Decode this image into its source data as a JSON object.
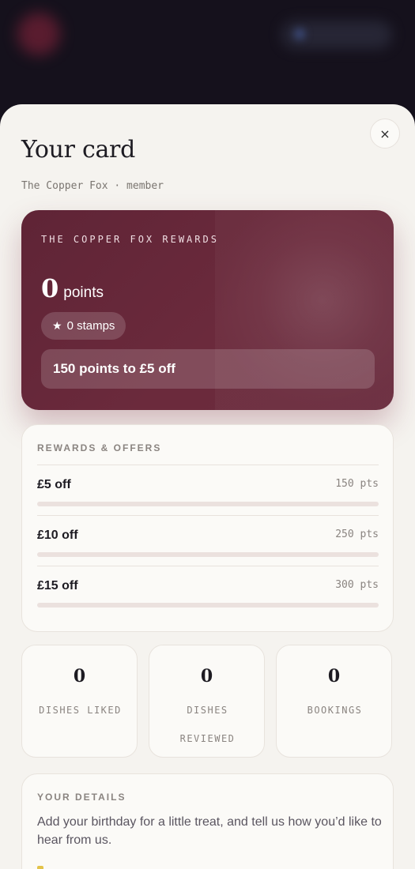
{
  "sheet": {
    "title": "Your card",
    "subtitle": "The Copper Fox · member",
    "close_label": "×"
  },
  "card": {
    "brand": "THE COPPER FOX REWARDS",
    "points_value": "0",
    "points_label": "points",
    "stamps_icon": "★",
    "stamps_label": "0 stamps",
    "next_reward": "150 points to £5 off",
    "accent_color": "#6b2a3c"
  },
  "rewards": {
    "heading": "REWARDS & OFFERS",
    "items": [
      {
        "name": "£5 off",
        "cost": "150 pts",
        "progress": 0
      },
      {
        "name": "£10 off",
        "cost": "250 pts",
        "progress": 0
      },
      {
        "name": "£15 off",
        "cost": "300 pts",
        "progress": 0
      }
    ]
  },
  "stats": [
    {
      "value": "0",
      "label": "DISHES LIKED"
    },
    {
      "value": "0",
      "label": "DISHES REVIEWED"
    },
    {
      "value": "0",
      "label": "BOOKINGS"
    }
  ],
  "details": {
    "heading": "YOUR DETAILS",
    "text": "Add your birthday for a little treat, and tell us how you’d like to hear from us."
  }
}
